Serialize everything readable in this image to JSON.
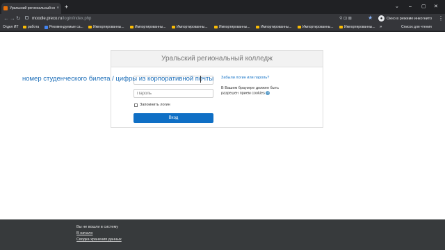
{
  "browser": {
    "tab": {
      "title": "Уральский региональный колле",
      "close": "×"
    },
    "new_tab": "+",
    "window_controls": [
      "⌄",
      "–",
      "▢",
      "✕"
    ],
    "nav": {
      "back": "←",
      "forward": "→",
      "reload": "↻"
    },
    "url": {
      "domain": "moodle.preco.ru",
      "path": "/login/index.php"
    },
    "omnibox_icons": "⚲  ⊡  ⊠",
    "star": "★",
    "profile": {
      "initial": "●",
      "label": "Окно в режиме инкогнито"
    },
    "more": "⋮"
  },
  "bookmarks": {
    "items": [
      {
        "label": "Отдел ИТ",
        "icon": "none"
      },
      {
        "label": "работа",
        "icon": "folder"
      },
      {
        "label": "Рекомендуемые са...",
        "icon": "bing"
      },
      {
        "label": "Импортированны...",
        "icon": "folder"
      },
      {
        "label": "Импортированны...",
        "icon": "folder"
      },
      {
        "label": "Импортированны...",
        "icon": "folder"
      },
      {
        "label": "Импортированны...",
        "icon": "folder"
      },
      {
        "label": "Импортированны...",
        "icon": "folder"
      },
      {
        "label": "Импортированны...",
        "icon": "folder"
      },
      {
        "label": "Импортированны...",
        "icon": "folder"
      }
    ],
    "overflow": "»",
    "reading_list": "Список для чтения"
  },
  "login": {
    "header": "Уральский региональный колледж",
    "password_placeholder": "Пароль",
    "remember_label": "Запомнить логин",
    "submit_label": "Вход",
    "forgot_link": "Забыли логин или пароль?",
    "cookies_note": "В Вашем браузере должен быть разрешен прием cookies",
    "help_icon": "?"
  },
  "annotation": "номер студенческого билета / цифры из корпоративной почты",
  "footer": {
    "status": "Вы не вошли в систему",
    "home_link": "В начало",
    "data_link": "Сводка хранения данных"
  }
}
